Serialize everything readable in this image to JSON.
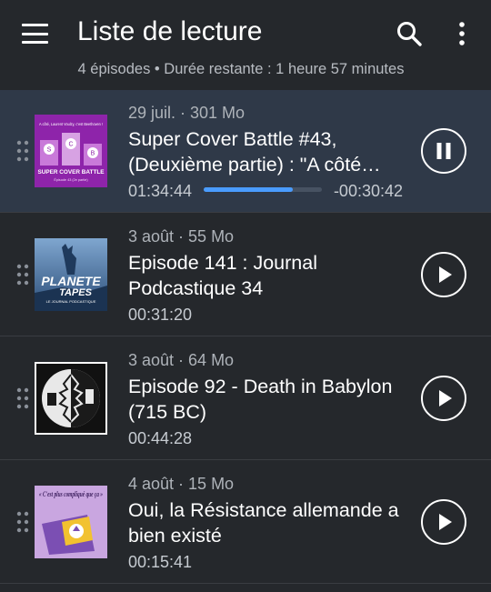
{
  "header": {
    "title": "Liste de lecture",
    "subtitle": "4 épisodes • Durée restante : 1 heure 57 minutes"
  },
  "episodes": [
    {
      "meta": "29 juil. · 301 Mo",
      "title": "Super Cover Battle #43, (Deuxième partie) : \"A côté…",
      "duration": "01:34:44",
      "remaining": "-00:30:42",
      "progress": 0.755,
      "state": "playing",
      "cover": {
        "top_text": "A côté, Laurent Voulzy, c'est Beethoven !",
        "letters": [
          "S",
          "C",
          "B"
        ],
        "bottom_text": "SUPER COVER BATTLE",
        "small_text": "Épisode 43 (2e partie)"
      }
    },
    {
      "meta": "3 août · 55 Mo",
      "title": "Episode 141 : Journal Podcastique 34",
      "duration": "00:31:20",
      "state": "paused",
      "cover": {
        "line1": "PLANETE",
        "line2": "TAPES",
        "line3": "LE JOURNAL PODCASTIQUE"
      }
    },
    {
      "meta": "3 août · 64 Mo",
      "title": "Episode 92 - Death in Babylon (715 BC)",
      "duration": "00:44:28",
      "state": "paused",
      "cover": {}
    },
    {
      "meta": "4 août · 15 Mo",
      "title": "Oui, la Résistance allemande a bien existé",
      "duration": "00:15:41",
      "state": "paused",
      "cover": {
        "top_text": "« C'est plus compliqué que ça »"
      }
    }
  ],
  "colors": {
    "background": "#25282c",
    "active_row": "#2f3948",
    "accent": "#4a9cff"
  },
  "icons": [
    "menu-icon",
    "search-icon",
    "more-vert-icon",
    "drag-handle-icon",
    "pause-icon",
    "play-icon"
  ]
}
